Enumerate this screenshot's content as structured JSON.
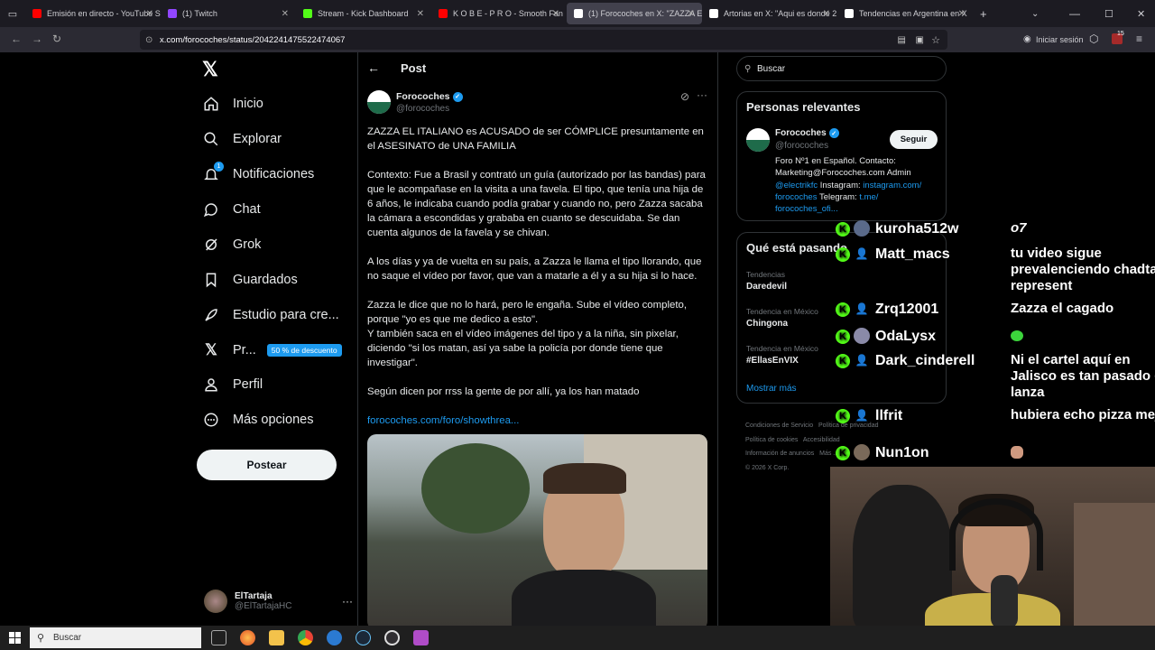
{
  "browser": {
    "tabs": [
      {
        "label": "Emisión en directo - YouTube St",
        "color": "#ff0000"
      },
      {
        "label": "(1) Twitch",
        "color": "#9146ff"
      },
      {
        "label": "Stream - Kick Dashboard",
        "color": "#53fc18"
      },
      {
        "label": "K O B E - P R O - Smooth Fan",
        "color": "#ff0000"
      },
      {
        "label": "(1) Forocoches en X: \"ZAZZA EL",
        "color": "#ffffff"
      },
      {
        "label": "Artorias en X: \"Aqui es donde 2",
        "color": "#ffffff"
      },
      {
        "label": "Tendencias en Argentina en X",
        "color": "#ffffff"
      }
    ],
    "url": "x.com/forocoches/status/2042241475522474067",
    "signin_label": "Iniciar sesión",
    "badge_count": "15"
  },
  "sidebar": {
    "items": [
      {
        "label": "Inicio",
        "icon": "home-icon"
      },
      {
        "label": "Explorar",
        "icon": "search-icon"
      },
      {
        "label": "Notificaciones",
        "icon": "bell-icon",
        "badge": "1"
      },
      {
        "label": "Chat",
        "icon": "chat-icon"
      },
      {
        "label": "Grok",
        "icon": "grok-icon"
      },
      {
        "label": "Guardados",
        "icon": "bookmark-icon"
      },
      {
        "label": "Estudio para cre...",
        "icon": "rocket-icon"
      },
      {
        "label": "Pr...",
        "icon": "x-icon",
        "promo": "50 % de descuento"
      },
      {
        "label": "Perfil",
        "icon": "user-icon"
      },
      {
        "label": "Más opciones",
        "icon": "more-icon"
      }
    ],
    "post_button": "Postear",
    "account": {
      "name": "ElTartaja",
      "handle": "@ElTartajaHC"
    }
  },
  "post": {
    "header": "Post",
    "author": "Forocoches",
    "handle": "@forocoches",
    "paragraphs": [
      "ZAZZA EL ITALIANO es ACUSADO de ser CÓMPLICE presuntamente en el ASESINATO de UNA FAMILIA",
      "Contexto: Fue a Brasil y contrató un guía (autorizado por las bandas) para que le acompañase en la visita a una favela. El tipo, que tenía una hija de 6 años, le indicaba cuando podía grabar y cuando no, pero Zazza sacaba la cámara a escondidas y grababa en cuanto se descuidaba. Se dan cuenta algunos de la favela y se chivan.",
      "A los días y ya de vuelta en su país, a Zazza le llama el tipo llorando, que no saque el vídeo por favor, que van a matarle a él y a su hija si lo hace.",
      "Zazza le dice que no lo hará, pero le engaña. Sube el vídeo completo, porque \"yo es que me dedico a esto\".\nY también saca en el vídeo imágenes del tipo y a la niña, sin pixelar, diciendo \"si los matan, así ya sabe la policía por donde tiene que investigar\".",
      "Según dicen por rrss la gente de por allí, ya los han matado"
    ],
    "link": "forocoches.com/foro/showthrea..."
  },
  "right": {
    "search_placeholder": "Buscar",
    "relevant_title": "Personas relevantes",
    "relevant": {
      "name": "Forocoches",
      "handle": "@forocoches",
      "follow": "Seguir",
      "bio_1": "Foro Nº1 en Español. Contacto:",
      "bio_2": "Marketing@Forocoches.com Admin",
      "bio_3a": "@electrikfc",
      "bio_3b": " Instagram: ",
      "bio_3c": "instagram.com/",
      "bio_4a": "forocoches",
      "bio_4b": " Telegram: ",
      "bio_4c": "t.me/",
      "bio_5": "forocoches_ofi..."
    },
    "happening_title": "Qué está pasando",
    "trends": [
      {
        "context": "Tendencias",
        "name": "Daredevil"
      },
      {
        "context": "Tendencia en México",
        "name": "Chingona"
      },
      {
        "context": "Tendencia en México",
        "name": "#EllasEnVIX"
      }
    ],
    "show_more": "Mostrar más",
    "footer": [
      "Condiciones de Servicio",
      "Política de privacidad",
      "Política de cookies",
      "Accesibilidad",
      "Información de anuncios",
      "Más ...",
      "© 2026 X Corp."
    ]
  },
  "chat": [
    {
      "user": "kuroha512w",
      "msg": "o7"
    },
    {
      "user": "Matt_macs",
      "msg": "tu video sigue prevalenciendo chadtaja represent"
    },
    {
      "user": "Zrq12001",
      "msg": "Zazza el cagado"
    },
    {
      "user": "OdaLysx",
      "msg": ""
    },
    {
      "user": "Dark_cinderell",
      "msg": "Ni el cartel aquí en Jalisco es tan pasado de lanza"
    },
    {
      "user": "llfrit",
      "msg": "hubiera echo pizza mejor"
    },
    {
      "user": "Nun1on",
      "msg": ""
    }
  ],
  "taskbar": {
    "search": "Buscar"
  }
}
